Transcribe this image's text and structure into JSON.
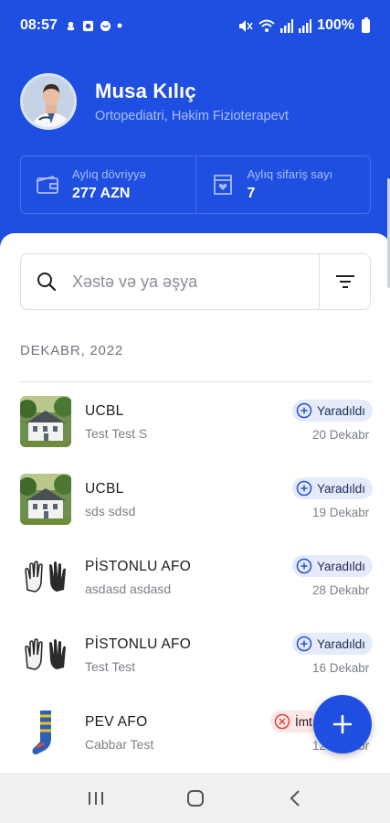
{
  "status_bar": {
    "time": "08:57",
    "battery": "100%",
    "icons": [
      "notification-icon",
      "media-icon",
      "app-icon",
      "dot-icon",
      "mute-icon",
      "wifi-icon",
      "signal-icon",
      "signal-icon",
      "battery-icon"
    ]
  },
  "profile": {
    "name": "Musa Kılıç",
    "role": "Ortopediatri, Həkim Fizioterapevt"
  },
  "stats": [
    {
      "label": "Aylıq dövriyyə",
      "value": "277 AZN",
      "icon": "wallet-icon"
    },
    {
      "label": "Aylıq sifariş sayı",
      "value": "7",
      "icon": "order-heart-icon"
    }
  ],
  "search": {
    "placeholder": "Xəstə və ya əşya"
  },
  "section": {
    "title": "DEKABR,  2022"
  },
  "orders": [
    {
      "title": "UCBL",
      "patient": "Test Test S",
      "status": "Yaradıldı",
      "status_type": "created",
      "date": "20 Dekabr",
      "thumb": "house-image"
    },
    {
      "title": "UCBL",
      "patient": "sds sdsd",
      "status": "Yaradıldı",
      "status_type": "created",
      "date": "19 Dekabr",
      "thumb": "house-image"
    },
    {
      "title": "PİSTONLU AFO",
      "patient": "asdasd asdasd",
      "status": "Yaradıldı",
      "status_type": "created",
      "date": "28 Dekabr",
      "thumb": "gloves-image"
    },
    {
      "title": "PİSTONLU AFO",
      "patient": "Test Test",
      "status": "Yaradıldı",
      "status_type": "created",
      "date": "16 Dekabr",
      "thumb": "gloves-image"
    },
    {
      "title": "PEV AFO",
      "patient": "Cabbar Test",
      "status": "İmt",
      "status_type": "cancelled",
      "date": "12 Dekabr",
      "thumb": "sock-image"
    }
  ],
  "colors": {
    "primary": "#1f4fe0",
    "created_badge": "#e5ebfa",
    "cancelled_badge": "#fde7e7",
    "cancel_icon": "#e0403a"
  }
}
